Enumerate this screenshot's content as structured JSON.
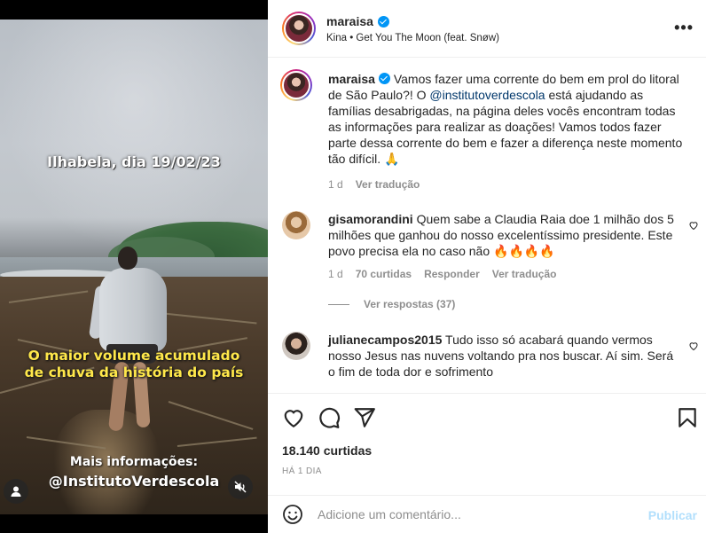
{
  "media": {
    "overlay_date": "Ilhabela, dia 19/02/23",
    "overlay_headline_line1": "O maior volume acumulado",
    "overlay_headline_line2": "de chuva da história do país",
    "overlay_info": "Mais informações:",
    "overlay_handle": "@InstitutoVerdescola",
    "user_tag_icon": "user-icon",
    "mute_icon": "speaker-muted-icon"
  },
  "header": {
    "username": "maraisa",
    "verified": true,
    "audio": "Kina • Get You The Moon (feat. Snøw)",
    "more": "•••"
  },
  "caption": {
    "username": "maraisa",
    "text_before_mention": " Vamos fazer uma corrente do bem em prol do litoral de São Paulo?! O ",
    "mention": "@institutoverdescola",
    "text_after_mention": " está ajudando as famílias desabrigadas, na página deles vocês encontram todas as informações para realizar as doações! Vamos todos fazer parte dessa corrente do bem e fazer a diferença neste momento tão difícil. 🙏",
    "time": "1 d",
    "translate": "Ver tradução"
  },
  "comments": [
    {
      "username": "gisamorandini",
      "text": " Quem sabe a Claudia Raia doe 1 milhão dos 5 milhões que ganhou do nosso excelentíssimo presidente. Este povo precisa ela no caso não 🔥🔥🔥🔥",
      "time": "1 d",
      "likes": "70 curtidas",
      "reply": "Responder",
      "translate": "Ver tradução",
      "view_replies": "Ver respostas (37)"
    },
    {
      "username": "julianecampos2015",
      "text": " Tudo isso só acabará quando vermos nosso Jesus nas nuvens voltando pra nos buscar. Aí sim. Será o fim de toda dor e sofrimento"
    }
  ],
  "actions": {
    "like_icon": "heart-icon",
    "comment_icon": "comment-icon",
    "share_icon": "paper-plane-icon",
    "save_icon": "bookmark-icon",
    "likes": "18.140 curtidas",
    "time_ago": "HÁ 1 DIA"
  },
  "add_comment": {
    "placeholder": "Adicione um comentário...",
    "publish": "Publicar",
    "emoji_icon": "smiley-icon"
  },
  "colors": {
    "verified": "#0095f6",
    "link": "#00376b",
    "publish_disabled": "#b2dffc",
    "secondary_text": "#8e8e8e"
  }
}
